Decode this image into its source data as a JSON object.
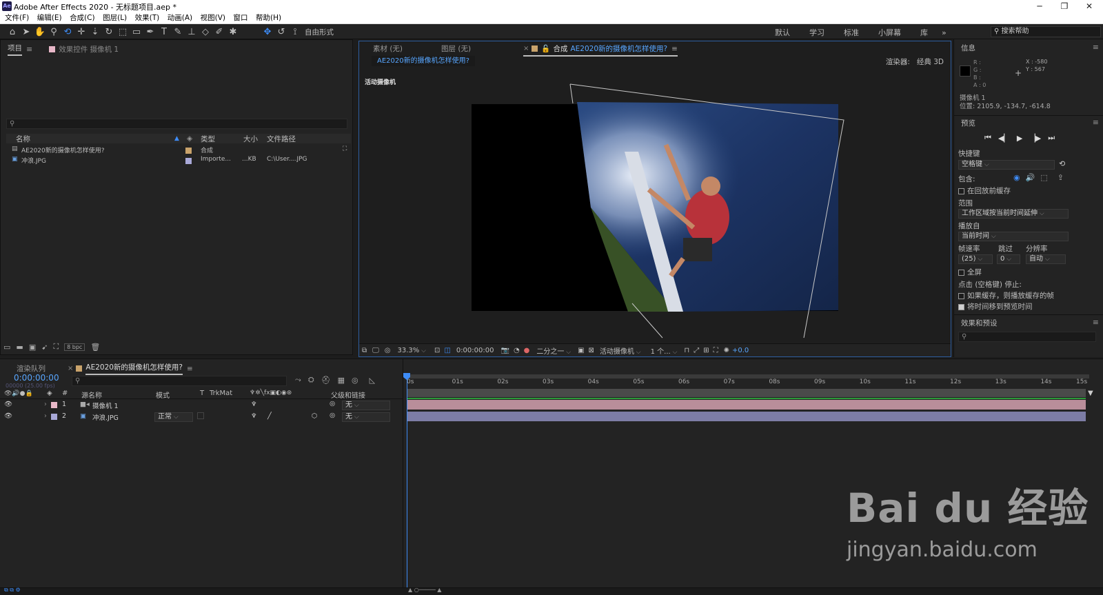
{
  "window": {
    "app_icon": "Ae",
    "title": "Adobe After Effects 2020 - 无标题项目.aep *"
  },
  "menu": [
    "文件(F)",
    "编辑(E)",
    "合成(C)",
    "图层(L)",
    "效果(T)",
    "动画(A)",
    "视图(V)",
    "窗口",
    "帮助(H)"
  ],
  "toolbar": {
    "freeform_label": "自由形式",
    "workspaces": [
      "默认",
      "学习",
      "标准",
      "小屏幕",
      "库"
    ],
    "more": "»",
    "search_help": "搜索帮助"
  },
  "project": {
    "tab_project": "项目",
    "tab_effects": "效果控件 摄像机 1",
    "search_icon": "⚲",
    "columns": [
      "名称",
      "类型",
      "大小",
      "文件路径"
    ],
    "items": [
      {
        "name": "AE2020新的摄像机怎样使用?",
        "type": "合成",
        "size": "",
        "path": "",
        "color": "#c9a36b"
      },
      {
        "name": "冲浪.JPG",
        "type": "Importe...",
        "size": "...KB",
        "path": "C:\\User....JPG",
        "color": "#a9a9d8"
      }
    ],
    "bpc": "8 bpc"
  },
  "comp": {
    "tab_footage": "素材 (无)",
    "tab_layer": "图层 (无)",
    "tab_comp_prefix": "合成",
    "tab_comp_name": "AE2020新的摄像机怎样使用?",
    "breadcrumb": "AE2020新的摄像机怎样使用?",
    "renderer_label": "渲染器:",
    "renderer_value": "经典 3D",
    "active_camera_label": "活动摄像机",
    "zoom": "33.3%",
    "timecode": "0:00:00:00",
    "resolution": "二分之一",
    "view": "活动摄像机",
    "views_count": "1 个...",
    "exposure": "+0.0"
  },
  "info": {
    "title": "信息",
    "r": "R :",
    "g": "G :",
    "b": "B :",
    "a": "A : 0",
    "x": "X : -580",
    "y": "Y : 567",
    "camera_name": "摄像机 1",
    "position": "位置: 2105.9, -134.7, -614.8"
  },
  "preview": {
    "title": "预览",
    "shortcut_label": "快捷键",
    "shortcut_value": "空格键",
    "include_label": "包含:",
    "cache_label": "在回放前缓存",
    "range_label": "范围",
    "range_value": "工作区域按当前时间延伸",
    "playfrom_label": "播放自",
    "playfrom_value": "当前时间",
    "fps_label": "帧速率",
    "skip_label": "跳过",
    "res_label": "分辨率",
    "fps_value": "(25)",
    "skip_value": "0",
    "res_value": "自动",
    "fullscreen_label": "全屏",
    "stop_label": "点击 (空格键) 停止:",
    "opt1": "如果缓存，则播放缓存的帧",
    "opt2": "将时间移到预览时间"
  },
  "effects": {
    "title": "效果和预设"
  },
  "timeline": {
    "tab_render": "渲染队列",
    "tab_comp": "AE2020新的摄像机怎样使用?",
    "timecode": "0:00:00:00",
    "frames": "00000 (25.00 fps)",
    "col_source": "源名称",
    "col_mode": "模式",
    "col_t": "T",
    "col_trkmat": "TrkMat",
    "col_parent": "父级和链接",
    "layers": [
      {
        "num": "1",
        "name": "摄像机 1",
        "mode": "",
        "parent": "无",
        "color": "#e8b8c8"
      },
      {
        "num": "2",
        "name": "冲浪.JPG",
        "mode": "正常",
        "parent": "无",
        "color": "#a9a9d8"
      }
    ],
    "ruler": [
      "0s",
      "01s",
      "02s",
      "03s",
      "04s",
      "05s",
      "06s",
      "07s",
      "08s",
      "09s",
      "10s",
      "11s",
      "12s",
      "13s",
      "14s",
      "15s"
    ]
  },
  "watermark": {
    "brand": "Bai du 经验",
    "url": "jingyan.baidu.com"
  }
}
